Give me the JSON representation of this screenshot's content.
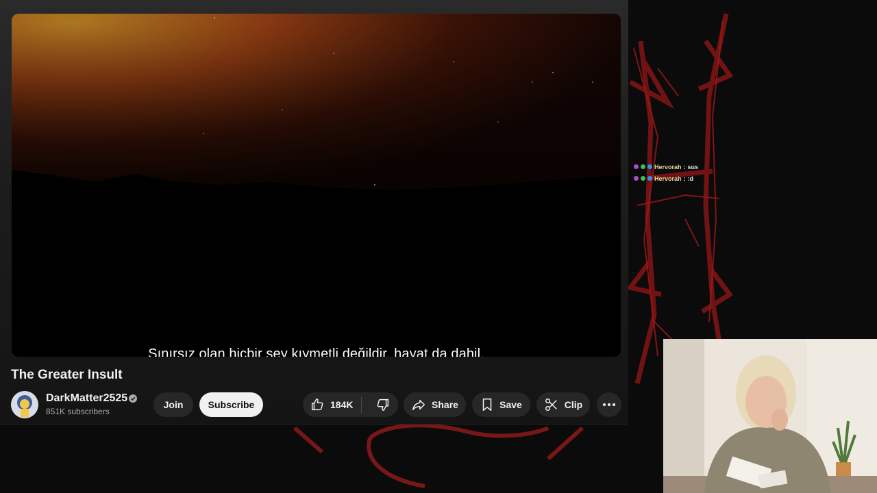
{
  "video": {
    "subtitle": "Sınırsız olan hiçbir şey kıymetli değildir, hayat da dahil.",
    "title": "The Greater Insult"
  },
  "channel": {
    "name": "DarkMatter2525",
    "subscribers": "851K subscribers"
  },
  "actions": {
    "join_label": "Join",
    "subscribe_label": "Subscribe",
    "like_count": "184K",
    "share_label": "Share",
    "save_label": "Save",
    "clip_label": "Clip"
  },
  "chat": {
    "messages": [
      {
        "user": "Hervorah",
        "text": "sus"
      },
      {
        "user": "Hervorah",
        "text": ":d"
      }
    ]
  },
  "icons": {
    "verified": "verified-check-icon",
    "like": "thumbs-up-icon",
    "dislike": "thumbs-down-icon",
    "share": "share-arrow-icon",
    "save": "bookmark-icon",
    "clip": "scissors-icon",
    "more": "more-horizontal-icon"
  },
  "colors": {
    "accent_red": "#8b1a1a",
    "pill_bg": "#272727",
    "subscribe_bg": "#f1f1f1"
  }
}
